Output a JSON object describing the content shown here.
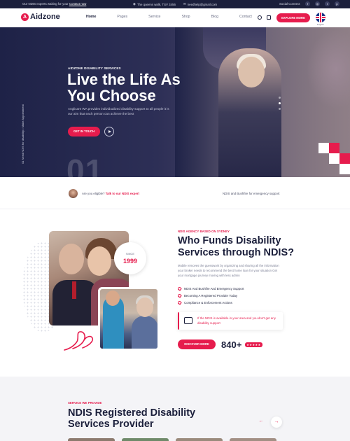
{
  "topbar": {
    "message": "Our NDIS experts waiting for your",
    "message_link": "Contact now",
    "address": "The queens walk, TSV 3456",
    "email": "needhelp@gmail.com",
    "social_label": "Social Connect",
    "social_icons": [
      "facebook-icon",
      "instagram-icon",
      "twitter-icon",
      "pinterest-icon"
    ]
  },
  "nav": {
    "logo_mark": "A",
    "logo_text": "Aidzone",
    "menu": [
      "Home",
      "Pages",
      "Service",
      "Shop",
      "Blog",
      "Contact"
    ],
    "active_item": "Home",
    "cta": "EXPLORE MORE",
    "language": "English"
  },
  "hero": {
    "side_text": "Need NDIS for disability • Make Appointment",
    "side_number": "01",
    "subtitle": "AIDZONE DISABILITY SERVICES",
    "title": "Live the Life As You Choose",
    "description": "Anglicare WA provides individualized disability support to all people it is our aim that each person can achieve the best",
    "cta": "GET IN TOUCH",
    "slide_number": "01",
    "slides": 3,
    "active_slide": 2
  },
  "eligibility": {
    "question": "Are you eligible?",
    "link": "Talk to our NDIS expert",
    "right_text": "NDIS and Bushfire for emergency support"
  },
  "about": {
    "since_label": "SINCE",
    "since_year": "1999",
    "subtitle": "NDIS AGENCY BASED ON SYDNEY",
    "title": "Who Funds Disability Services through NDIS?",
    "description": "Mobile removes the guesswork by organizing and sharing all the information your broker needs to recommend the best home loan for your situation Get your mortgage journey moving with less admin",
    "checklist": [
      "NDIS And Bushfire And Emergency Support",
      "Becoming A Registered Provider Today",
      "Compliance & Enforcement Actions"
    ],
    "notice": "If the NDIS is available in your area and you don't get any disability support",
    "cta": "DISCOVER MORE",
    "count": "840+",
    "stars": "★★★★★"
  },
  "services": {
    "subtitle": "SERVICE WE PROVIDE",
    "title": "NDIS Registered Disability Services Provider",
    "prev": "←",
    "next": "→"
  },
  "colors": {
    "accent": "#e61c4d",
    "dark": "#1b1f3b",
    "hero_bg": "#1e2247",
    "light_bg": "#f4f4f7"
  }
}
